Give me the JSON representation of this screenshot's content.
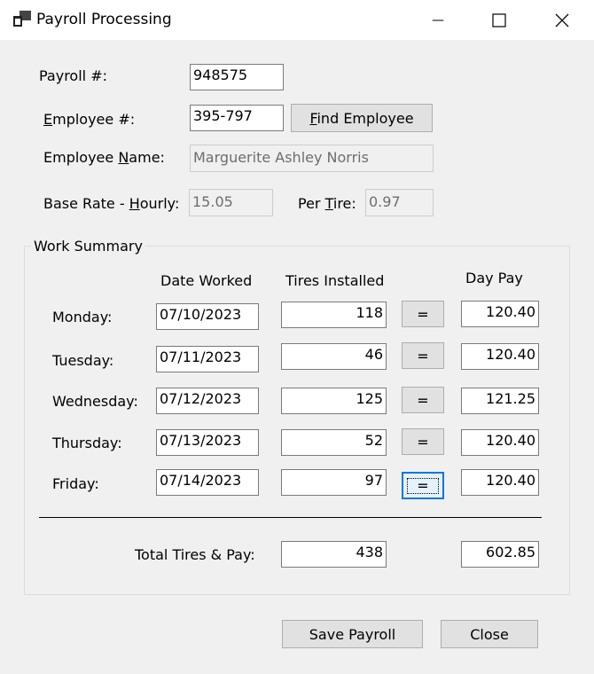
{
  "window": {
    "title": "Payroll Processing",
    "minimize_glyph": "—",
    "icons": {
      "app": "app-icon",
      "minimize": "minimize-icon",
      "maximize": "maximize-icon",
      "close": "close-icon"
    }
  },
  "header": {
    "payroll_label": "Payroll #:",
    "payroll_value": "948575",
    "employee_label_pre": "",
    "employee_label_key": "E",
    "employee_label_post": "mployee #:",
    "employee_value": "395-797",
    "find_button_key": "F",
    "find_button_post": "ind Employee",
    "name_label_pre": "Employee ",
    "name_label_key": "N",
    "name_label_post": "ame:",
    "name_value": "Marguerite Ashley Norris",
    "base_rate_label_pre": "Base Rate - ",
    "base_rate_label_key": "H",
    "base_rate_label_post": "ourly:",
    "base_rate_value": "15.05",
    "per_tire_label_pre": "Per ",
    "per_tire_label_key": "T",
    "per_tire_label_post": "ire:",
    "per_tire_value": "0.97"
  },
  "work_summary": {
    "title": "Work Summary",
    "col_date": "Date Worked",
    "col_tires": "Tires Installed",
    "col_pay": "Day Pay",
    "calc_label": "=",
    "days": [
      {
        "label": "Monday:",
        "date": "07/10/2023",
        "tires": "118",
        "pay": "120.40"
      },
      {
        "label": "Tuesday:",
        "date": "07/11/2023",
        "tires": "46",
        "pay": "120.40"
      },
      {
        "label": "Wednesday:",
        "date": "07/12/2023",
        "tires": "125",
        "pay": "121.25"
      },
      {
        "label": "Thursday:",
        "date": "07/13/2023",
        "tires": "52",
        "pay": "120.40"
      },
      {
        "label": "Friday:",
        "date": "07/14/2023",
        "tires": "97",
        "pay": "120.40"
      }
    ],
    "total_label": "Total Tires & Pay:",
    "total_tires": "438",
    "total_pay": "602.85"
  },
  "footer": {
    "save_label": "Save Payroll",
    "close_label": "Close"
  }
}
